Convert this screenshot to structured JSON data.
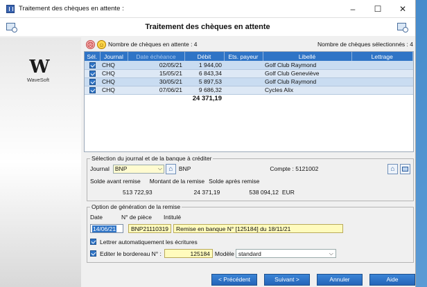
{
  "window": {
    "title": "Traitement des chèques en attente :",
    "minimize": "–",
    "maximize": "☐",
    "close": "✕"
  },
  "header": {
    "title": "Traitement des chèques en attente"
  },
  "logo": {
    "text": "WaveSoft"
  },
  "status": {
    "pending": "Nombre de chèques en attente : 4",
    "selected": "Nombre de chèques sélectionnés : 4"
  },
  "table": {
    "columns": [
      "Sél.",
      "Journal",
      "Date échéance",
      "Débit",
      "Ets. payeur",
      "Libellé",
      "Lettrage"
    ],
    "rows": [
      {
        "journal": "CHQ",
        "date": "02/05/21",
        "debit": "1 944,00",
        "payer": "",
        "label": "Golf Club Raymond",
        "lettrage": ""
      },
      {
        "journal": "CHQ",
        "date": "15/05/21",
        "debit": "6 843,34",
        "payer": "",
        "label": "Golf Club Geneviève",
        "lettrage": ""
      },
      {
        "journal": "CHQ",
        "date": "30/05/21",
        "debit": "5 897,53",
        "payer": "",
        "label": "Golf Club Raymond",
        "lettrage": ""
      },
      {
        "journal": "CHQ",
        "date": "07/06/21",
        "debit": "9 686,32",
        "payer": "",
        "label": "Cycles Alix",
        "lettrage": ""
      }
    ],
    "total": "24 371,19"
  },
  "journal_section": {
    "legend": "Sélection du journal et de la banque à créditer",
    "journal_label": "Journal",
    "journal_value": "BNP",
    "bank": "BNP",
    "compte": "Compte : 5121002",
    "before_label": "Solde avant remise",
    "amount_label": "Montant de la remise",
    "after_label": "Solde après remise",
    "before_value": "513 722,93",
    "amount_value": "24 371,19",
    "after_value": "538 094,12",
    "currency": "EUR"
  },
  "options": {
    "legend": "Option de génération de la remise",
    "date_label": "Date",
    "piece_label": "N° de pièce",
    "intitule_label": "Intitulé",
    "date_value": "14/06/21",
    "piece_value": "BNP21110319",
    "intitule_value": "Remise en banque N° [125184] du 18/11/21",
    "lettrer_label": "Lettrer automatiquement les écritures",
    "bordereau_label": "Editer le bordereau N° :",
    "bordereau_value": "125184",
    "modele_label": "Modèle",
    "modele_value": "standard"
  },
  "buttons": {
    "prev": "< Précédent",
    "next": "Suivant >",
    "cancel": "Annuler",
    "help": "Aide"
  }
}
